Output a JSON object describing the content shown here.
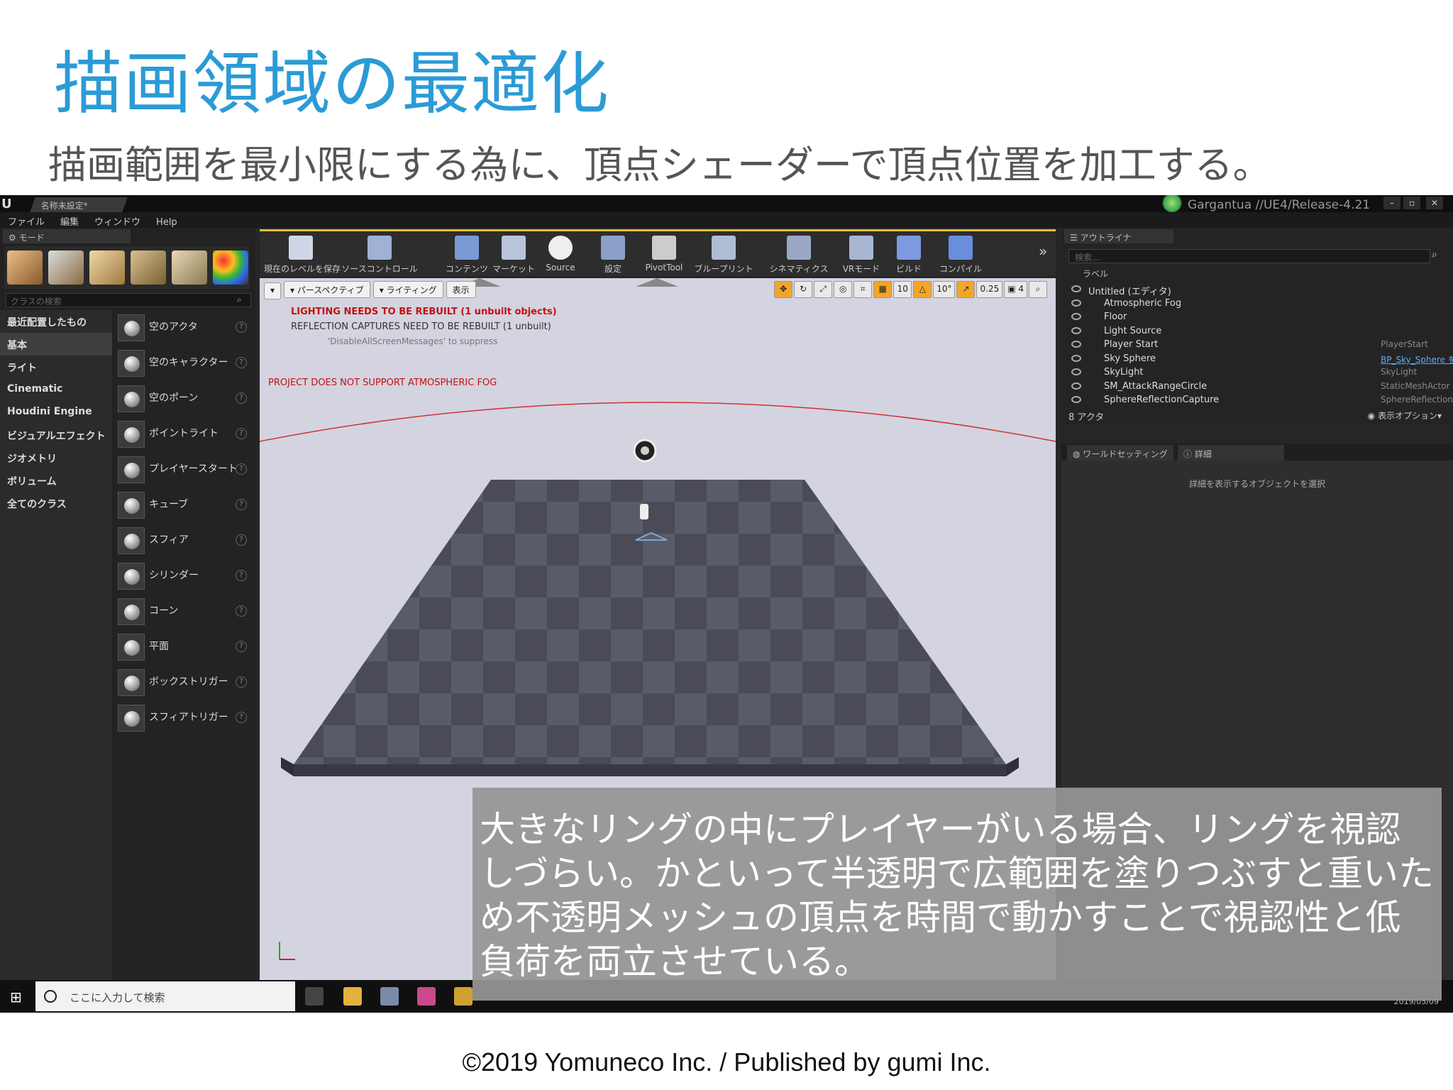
{
  "slide": {
    "title": "描画領域の最適化",
    "subtitle": "描画範囲を最小限にする為に、頂点シェーダーで頂点位置を加工する。",
    "caption": "大きなリングの中にプレイヤーがいる場合、リングを視認しづらい。かといって半透明で広範囲を塗りつぶすと重いため不透明メッシュの頂点を時間で動かすことで視認性と低負荷を両立させている。",
    "footer": "©2019 Yomuneco Inc. / Published by gumi Inc."
  },
  "window": {
    "tab": "名称未設定*",
    "project": "Gargantua //UE4/Release-4.21",
    "menu": [
      "ファイル",
      "編集",
      "ウィンドウ",
      "Help"
    ]
  },
  "modes": {
    "tab": "モード",
    "search_placeholder": "クラスの検索",
    "categories": [
      "最近配置したもの",
      "基本",
      "ライト",
      "Cinematic",
      "Houdini Engine",
      "ビジュアルエフェクト",
      "ジオメトリ",
      "ボリューム",
      "全てのクラス"
    ],
    "items": [
      "空のアクタ",
      "空のキャラクター",
      "空のポーン",
      "ポイントライト",
      "プレイヤースタート",
      "キューブ",
      "スフィア",
      "シリンダー",
      "コーン",
      "平面",
      "ボックストリガー",
      "スフィアトリガー"
    ]
  },
  "toolbar": {
    "buttons": [
      "現在のレベルを保存",
      "ソースコントロール",
      "コンテンツ",
      "マーケット",
      "Source",
      "設定",
      "PivotTool",
      "ブループリント",
      "シネマティクス",
      "VRモード",
      "ビルド",
      "コンパイル"
    ]
  },
  "viewport": {
    "perspective": "パースペクティブ",
    "lighting": "ライティング",
    "show": "表示",
    "snap_grid": "10",
    "snap_rot": "10°",
    "snap_scale": "0.25",
    "cam_speed": "4",
    "warn1": "LIGHTING NEEDS TO BE REBUILT (1 unbuilt objects)",
    "warn2": "REFLECTION CAPTURES NEED TO BE REBUILT (1 unbuilt)",
    "warn3": "'DisableAllScreenMessages' to suppress",
    "warn4": "PROJECT DOES NOT SUPPORT ATMOSPHERIC FOG"
  },
  "outliner": {
    "tab": "アウトライナ",
    "search_placeholder": "検索...",
    "header": "ラベル",
    "rows": [
      {
        "name": "Untitled (エディタ)",
        "type": ""
      },
      {
        "name": "Atmospheric Fog",
        "type": ""
      },
      {
        "name": "Floor",
        "type": ""
      },
      {
        "name": "Light Source",
        "type": ""
      },
      {
        "name": "Player Start",
        "type": "PlayerStart"
      },
      {
        "name": "Sky Sphere",
        "type": "BP_Sky_Sphere を編集"
      },
      {
        "name": "SkyLight",
        "type": "SkyLight"
      },
      {
        "name": "SM_AttackRangeCircle",
        "type": "StaticMeshActor"
      },
      {
        "name": "SphereReflectionCapture",
        "type": "SphereReflectionCapture"
      }
    ],
    "count": "8 アクタ",
    "view_options": "表示オプション"
  },
  "details": {
    "tab_world": "ワールドセッティング",
    "tab_details": "詳細",
    "message": "詳細を表示するオブジェクトを選択"
  },
  "taskbar": {
    "search_placeholder": "ここに入力して検索",
    "date": "2019/05/09"
  },
  "colors": {
    "title": "#2b9bd6",
    "warning": "#c41111",
    "toolbar_accent": "#e8c028",
    "outliner_accent": "#88c22f"
  }
}
